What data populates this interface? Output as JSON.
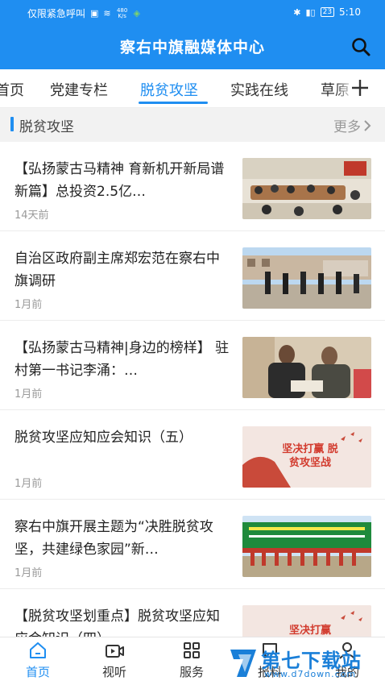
{
  "status_bar": {
    "carrier": "仅限紧急呼叫",
    "net_speed": "480\nK/s",
    "battery": "23",
    "time": "5:10"
  },
  "header": {
    "title": "察右中旗融媒体中心",
    "search_icon": "search-icon"
  },
  "tabs": [
    {
      "label": "首页",
      "active": false
    },
    {
      "label": "党建专栏",
      "active": false
    },
    {
      "label": "脱贫攻坚",
      "active": true
    },
    {
      "label": "实践在线",
      "active": false
    },
    {
      "label": "草原",
      "active": false
    }
  ],
  "section": {
    "title": "脱贫攻坚",
    "more": "更多"
  },
  "news": [
    {
      "title": "【弘扬蒙古马精神 育新机开新局谱新篇】总投资2.5亿…",
      "time": "14天前"
    },
    {
      "title": "自治区政府副主席郑宏范在察右中旗调研",
      "time": "1月前"
    },
    {
      "title": "【弘扬蒙古马精神|身边的榜样】 驻村第一书记李涌：…",
      "time": "1月前"
    },
    {
      "title": "脱贫攻坚应知应会知识（五）",
      "time": "1月前",
      "thumb_text": "坚决打赢 脱贫攻坚战"
    },
    {
      "title": "察右中旗开展主题为“决胜脱贫攻坚，共建绿色家园”新…",
      "time": "1月前"
    },
    {
      "title": "【脱贫攻坚划重点】脱贫攻坚应知应会知识（四）",
      "time": "",
      "thumb_text": "坚决打赢"
    }
  ],
  "bottom_nav": [
    {
      "label": "首页",
      "icon": "home-icon",
      "active": true
    },
    {
      "label": "视听",
      "icon": "video-icon",
      "active": false
    },
    {
      "label": "服务",
      "icon": "grid-icon",
      "active": false
    },
    {
      "label": "报料",
      "icon": "report-icon",
      "active": false
    },
    {
      "label": "我的",
      "icon": "user-icon",
      "active": false
    }
  ],
  "watermark": {
    "name": "第七下载站",
    "url": "www.d7down.com"
  },
  "colors": {
    "brand": "#1f8ef1",
    "section_bg": "#f2f2f2"
  }
}
